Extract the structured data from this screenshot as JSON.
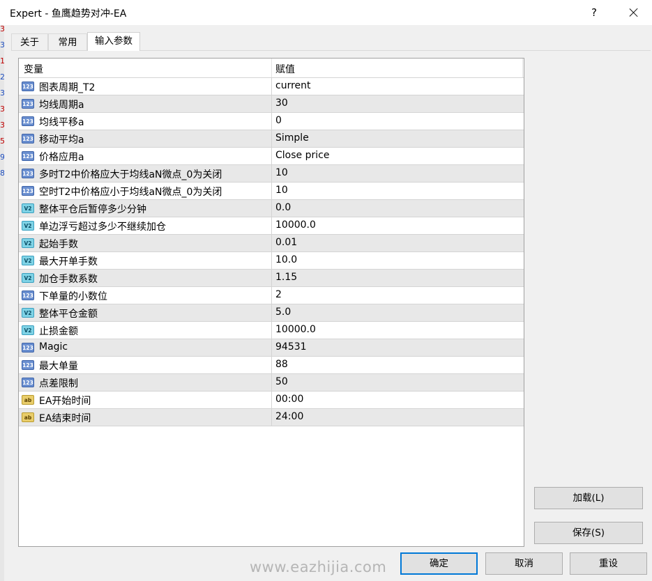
{
  "window": {
    "title": "Expert - 鱼鹰趋势对冲-EA",
    "help_label": "?"
  },
  "tabs": [
    {
      "label": "关于",
      "active": false
    },
    {
      "label": "常用",
      "active": false
    },
    {
      "label": "输入参数",
      "active": true
    }
  ],
  "grid": {
    "headers": {
      "variable": "变量",
      "value": "赋值"
    },
    "rows": [
      {
        "type": "int",
        "icon_text": "123",
        "name": "图表周期_T2",
        "value": "current"
      },
      {
        "type": "int",
        "icon_text": "123",
        "name": "均线周期a",
        "value": "30"
      },
      {
        "type": "int",
        "icon_text": "123",
        "name": "均线平移a",
        "value": "0"
      },
      {
        "type": "int",
        "icon_text": "123",
        "name": "移动平均a",
        "value": "Simple"
      },
      {
        "type": "int",
        "icon_text": "123",
        "name": "价格应用a",
        "value": "Close price"
      },
      {
        "type": "int",
        "icon_text": "123",
        "name": "多时T2中价格应大于均线aN微点_0为关闭",
        "value": "10"
      },
      {
        "type": "int",
        "icon_text": "123",
        "name": "空时T2中价格应小于均线aN微点_0为关闭",
        "value": "10"
      },
      {
        "type": "double",
        "icon_text": "V2",
        "name": "整体平仓后暂停多少分钟",
        "value": "0.0"
      },
      {
        "type": "double",
        "icon_text": "V2",
        "name": "单边浮亏超过多少不继续加仓",
        "value": "10000.0"
      },
      {
        "type": "double",
        "icon_text": "V2",
        "name": "起始手数",
        "value": "0.01"
      },
      {
        "type": "double",
        "icon_text": "V2",
        "name": "最大开单手数",
        "value": "10.0"
      },
      {
        "type": "double",
        "icon_text": "V2",
        "name": "加仓手数系数",
        "value": "1.15"
      },
      {
        "type": "int",
        "icon_text": "123",
        "name": "下单量的小数位",
        "value": "2"
      },
      {
        "type": "double",
        "icon_text": "V2",
        "name": "整体平仓金额",
        "value": "5.0"
      },
      {
        "type": "double",
        "icon_text": "V2",
        "name": "止损金额",
        "value": "10000.0"
      },
      {
        "type": "int",
        "icon_text": "123",
        "name": "Magic",
        "value": "94531"
      },
      {
        "type": "int",
        "icon_text": "123",
        "name": "最大单量",
        "value": "88"
      },
      {
        "type": "int",
        "icon_text": "123",
        "name": "点差限制",
        "value": "50"
      },
      {
        "type": "string",
        "icon_text": "ab",
        "name": "EA开始时间",
        "value": "00:00"
      },
      {
        "type": "string",
        "icon_text": "ab",
        "name": "EA结束时间",
        "value": "24:00"
      }
    ]
  },
  "buttons": {
    "load": "加载(L)",
    "save": "保存(S)",
    "ok": "确定",
    "cancel": "取消",
    "reset": "重设"
  },
  "watermark": "www.eazhijia.com",
  "left_strip_chars": [
    "3",
    "3",
    "1",
    "2",
    "3",
    "3",
    "3",
    "5",
    "9",
    "8"
  ]
}
